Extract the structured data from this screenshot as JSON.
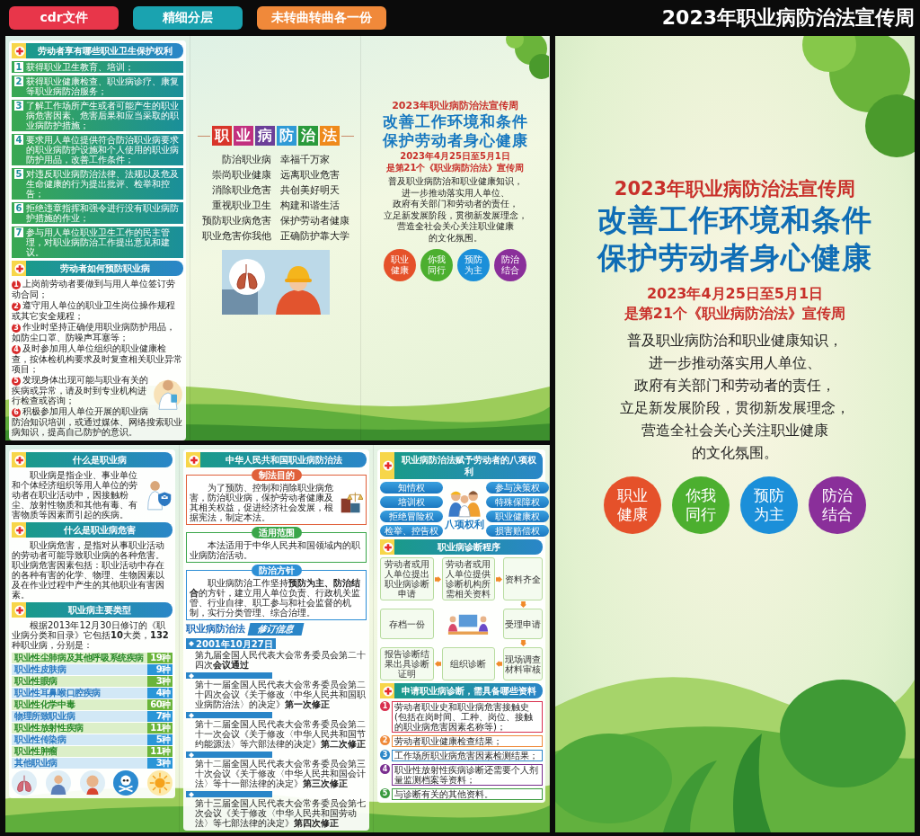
{
  "header_badges": [
    {
      "text": "cdr文件",
      "color": "#e8364a"
    },
    {
      "text": "精细分层",
      "color": "#1aa3b0"
    },
    {
      "text": "未转曲转曲各一份",
      "color": "#f0893a"
    }
  ],
  "page_title": "2023年职业病防治法宣传周",
  "brochure_outside": {
    "rights": {
      "title": "劳动者享有哪些职业卫生保护权利",
      "items": [
        {
          "number": "1",
          "text": "获得职业卫生教育、培训；"
        },
        {
          "number": "2",
          "text": "获得职业健康检查、职业病诊疗、康复等职业病防治服务；"
        },
        {
          "number": "3",
          "text": "了解工作场所产生或者可能产生的职业病危害因素、危害后果和应当采取的职业病防护措施；"
        },
        {
          "number": "4",
          "text": "要求用人单位提供符合防治职业病要求的职业病防护设施和个人使用的职业病防护用品，改善工作条件；"
        },
        {
          "number": "5",
          "text": "对违反职业病防治法律、法规以及危及生命健康的行为提出批评、检举和控告；"
        },
        {
          "number": "6",
          "text": "拒绝违章指挥和强令进行没有职业病防护措施的作业；"
        },
        {
          "number": "7",
          "text": "参与用人单位职业卫生工作的民主管理，对职业病防治工作提出意见和建议。"
        }
      ]
    },
    "prevention": {
      "title": "劳动者如何预防职业病",
      "items": [
        {
          "number": "1",
          "text": "上岗前劳动者要做到与用人单位签订劳动合同；"
        },
        {
          "number": "2",
          "text": "遵守用人单位的职业卫生岗位操作规程或其它安全规程；"
        },
        {
          "number": "3",
          "text": "作业时坚持正确使用职业病防护用品，如防尘口罩、防噪声耳塞等；"
        },
        {
          "number": "4",
          "text": "及时参加用人单位组织的职业健康检查，按体检机构要求及时复查相关职业异常项目；"
        },
        {
          "number": "5",
          "text": "发现身体出现可能与职业有关的疾病或异常，请及时到专业机构进行检查或咨询；"
        },
        {
          "number": "6",
          "text": "积极参加用人单位开展的职业病防治知识培训，或通过媒体、网络搜索职业病知识，提高自己防护的意识。"
        }
      ]
    },
    "law_tiles": [
      {
        "text": "职",
        "color": "#d8352a"
      },
      {
        "text": "业",
        "color": "#c2307f"
      },
      {
        "text": "病",
        "color": "#6b3f98"
      },
      {
        "text": "防",
        "color": "#2f9ad6"
      },
      {
        "text": "治",
        "color": "#2a9a3c"
      },
      {
        "text": "法",
        "color": "#ef8a1c"
      }
    ],
    "slogans": [
      {
        "left": "防治职业病",
        "right": "幸福千万家"
      },
      {
        "left": "崇尚职业健康",
        "right": "远离职业危害"
      },
      {
        "left": "消除职业危害",
        "right": "共创美好明天"
      },
      {
        "left": "重视职业卫生",
        "right": "构建和谐生活"
      },
      {
        "left": "预防职业病危害",
        "right": "保护劳动者健康"
      },
      {
        "left": "职业危害你我他",
        "right": "正确防护靠大学"
      }
    ],
    "cover": {
      "kicker": "2023年职业病防治法宣传周",
      "headline": [
        "改善工作环境和条件",
        "保护劳动者身心健康"
      ],
      "date": "2023年4月25日至5月1日",
      "subtitle": "是第21个《职业病防治法》宣传周",
      "body": [
        "普及职业病防治和职业健康知识，",
        "进一步推动落实用人单位、",
        "政府有关部门和劳动者的责任，",
        "立足新发展阶段，贯彻新发展理念，",
        "营造全社会关心关注职业健康",
        "的文化氛围。"
      ],
      "badges": [
        {
          "lines": [
            "职业",
            "健康"
          ],
          "color": "#e5512a"
        },
        {
          "lines": [
            "你我",
            "同行"
          ],
          "color": "#4caf2f"
        },
        {
          "lines": [
            "预防",
            "为主"
          ],
          "color": "#1b8fd9"
        },
        {
          "lines": [
            "防治",
            "结合"
          ],
          "color": "#8a2f9a"
        }
      ]
    }
  },
  "brochure_inside": {
    "definitions": [
      {
        "title": "什么是职业病",
        "text": "职业病是指企业、事业单位和个体经济组织等用人单位的劳动者在职业活动中，因接触粉尘、放射性物质和其他有毒、有害物质等因素而引起的疾病。"
      },
      {
        "title": "什么是职业病危害",
        "text": "职业病危害，是指对从事职业活动的劳动者可能导致职业病的各种危害。职业病危害因素包括：职业活动中存在的各种有害的化学、物理、生物因素以及在作业过程中产生的其他职业有害因素。"
      },
      {
        "title": "职业病主要类型",
        "text": "根据2013年12月30日修订的《职业病分类和目录》它包括**10**大类，**132**种职业病，分别是："
      }
    ],
    "disease_types": [
      {
        "name": "职业性尘肺病及其他呼吸系统疾病",
        "count": "19种"
      },
      {
        "name": "职业性皮肤病",
        "count": "9种"
      },
      {
        "name": "职业性眼病",
        "count": "3种"
      },
      {
        "name": "职业性耳鼻喉口腔疾病",
        "count": "4种"
      },
      {
        "name": "职业性化学中毒",
        "count": "60种"
      },
      {
        "name": "物理所致职业病",
        "count": "7种"
      },
      {
        "name": "职业性放射性疾病",
        "count": "11种"
      },
      {
        "name": "职业性传染病",
        "count": "5种"
      },
      {
        "name": "职业性肿瘤",
        "count": "11种"
      },
      {
        "name": "其他职业病",
        "count": "3种"
      }
    ],
    "law": {
      "title": "中华人民共和国职业病防治法",
      "boxes": [
        {
          "label": "制法目的",
          "color": "#e0603a",
          "text": "为了预防、控制和消除职业病危害，防治职业病，保护劳动者健康及其相关权益，促进经济社会发展，根据宪法，制定本法。"
        },
        {
          "label": "适用范围",
          "color": "#3aa64a",
          "text": "本法适用于中华人民共和国领域内的职业病防治活动。"
        },
        {
          "label": "防治方针",
          "color": "#2d8fd6",
          "text": "职业病防治工作坚持**预防为主、防治结合**的方针，建立用人单位负责、行政机关监管、行业自律、职工参与和社会监督的机制，实行分类管理、综合治理。"
        }
      ],
      "revision_title": "职业病防治法",
      "revision_tag": "修订信息",
      "revisions": [
        {
          "date": "2001年10月27日",
          "text": "第九届全国人民代表大会常务委员会第二十四次**会议通过**"
        },
        {
          "text": "第十一届全国人民代表大会常务委员会第二十四次会议《关于修改〈中华人民共和国职业病防治法〉的决定》**第一次修正**"
        },
        {
          "text": "第十二届全国人民代表大会常务委员会第二十一次会议《关于修改〈中华人民共和国节约能源法〉等六部法律的决定》**第二次修正**"
        },
        {
          "text": "第十二届全国人民代表大会常务委员会第三十次会议《关于修改〈中华人民共和国会计法〉等十一部法律的决定》**第三次修正**"
        },
        {
          "text": "第十三届全国人民代表大会常务委员会第七次会议《关于修改〈中华人民共和国劳动法〉等七部法律的决定》**第四次修正**"
        }
      ]
    },
    "eight_rights": {
      "title": "职业病防治法赋予劳动者的八项权利",
      "left": [
        "知情权",
        "培训权",
        "拒绝冒险权",
        "检举、控告权"
      ],
      "center": "八项权利",
      "right": [
        "参与决策权",
        "特殊保障权",
        "职业健康权",
        "损害赔偿权"
      ]
    },
    "diagnosis": {
      "title": "职业病诊断程序",
      "steps": [
        "劳动者或用人单位提出职业病诊断申请",
        "劳动者或用人单位提供诊断机构所需相关资料",
        "资料齐全",
        "存档一份",
        "受理申请",
        "报告诊断结果出具诊断证明",
        "组织诊断",
        "现场调查材料审核"
      ]
    },
    "materials": {
      "title": "申请职业病诊断，需具备哪些资料",
      "items": [
        {
          "number": "1",
          "color": "#d8304f",
          "text": "劳动者职业史和职业病危害接触史(包括在岗时间、工种、岗位、接触的职业病危害因素名称等)；"
        },
        {
          "number": "2",
          "color": "#ef8a3a",
          "text": "劳动者职业健康检查结果；"
        },
        {
          "number": "3",
          "color": "#2a86c8",
          "text": "工作场所职业病危害因素检测结果；"
        },
        {
          "number": "4",
          "color": "#7a2f8f",
          "text": "职业性放射性疾病诊断还需要个人剂量监测档案等资料；"
        },
        {
          "number": "5",
          "color": "#3a9a3f",
          "text": "与诊断有关的其他资料。"
        }
      ]
    }
  },
  "poster": {
    "kicker": "2023年职业病防治法宣传周",
    "headline": [
      "改善工作环境和条件",
      "保护劳动者身心健康"
    ],
    "date": "2023年4月25日至5月1日",
    "subtitle": "是第21个《职业病防治法》宣传周",
    "body": [
      "普及职业病防治和职业健康知识，",
      "进一步推动落实用人单位、",
      "政府有关部门和劳动者的责任，",
      "立足新发展阶段，贯彻新发展理念，",
      "营造全社会关心关注职业健康",
      "的文化氛围。"
    ],
    "badges": [
      {
        "lines": [
          "职业",
          "健康"
        ],
        "color": "#e5512a"
      },
      {
        "lines": [
          "你我",
          "同行"
        ],
        "color": "#4caf2f"
      },
      {
        "lines": [
          "预防",
          "为主"
        ],
        "color": "#1b8fd9"
      },
      {
        "lines": [
          "防治",
          "结合"
        ],
        "color": "#8a2f9a"
      }
    ]
  }
}
